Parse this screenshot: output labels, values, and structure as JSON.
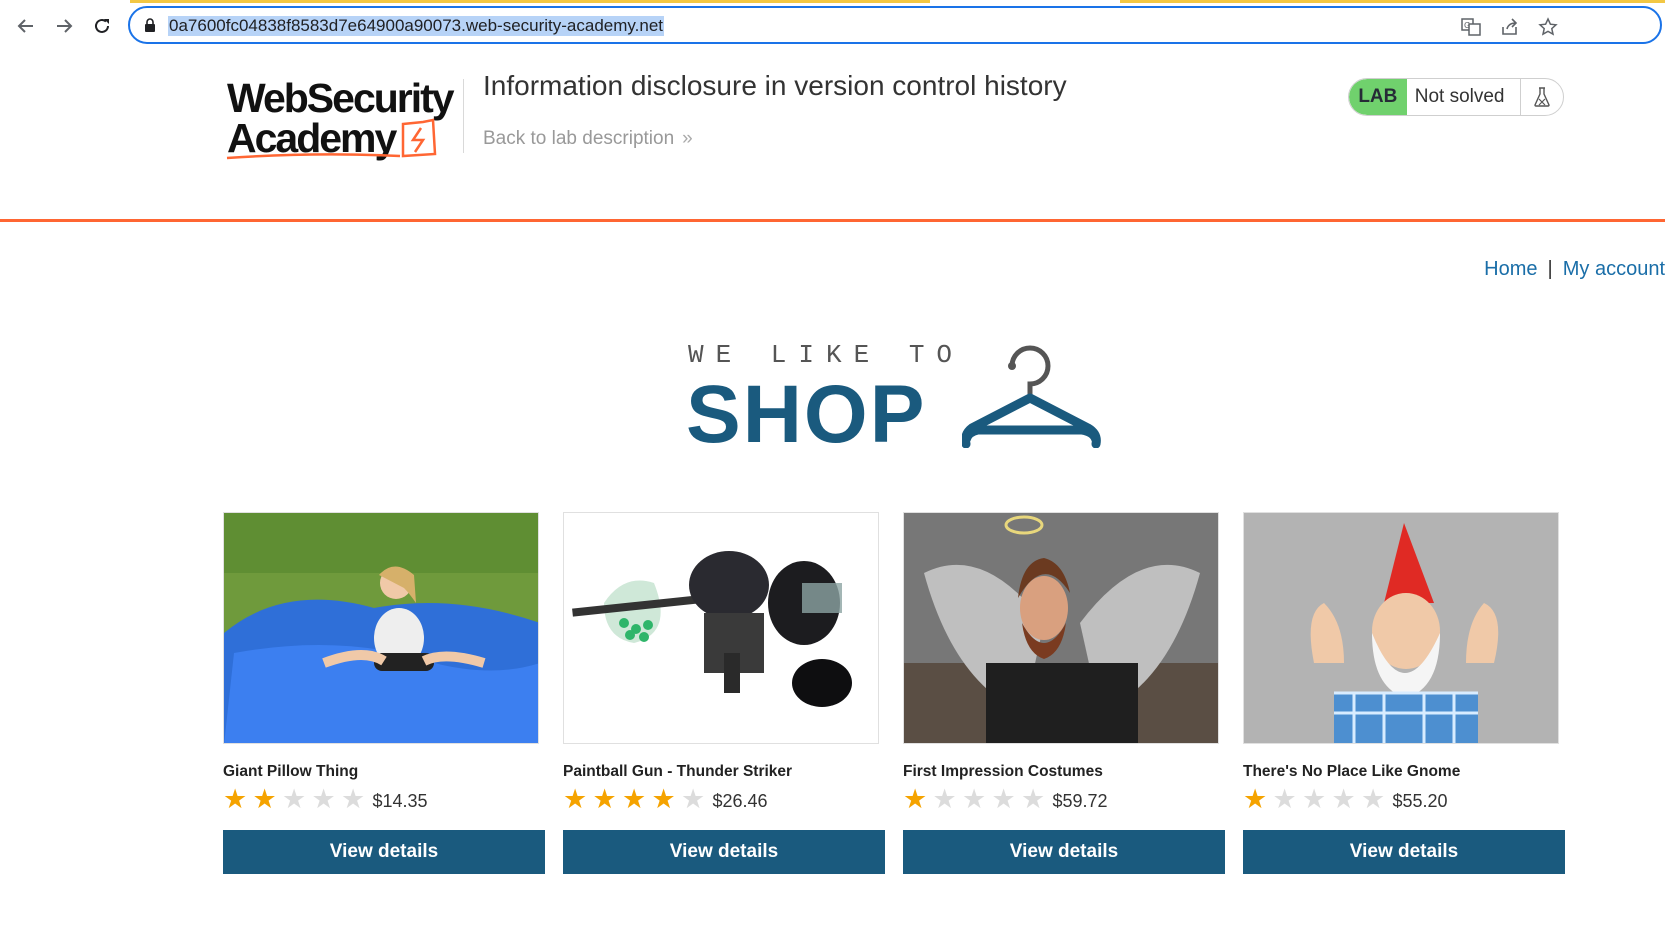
{
  "browser": {
    "url": "0a7600fc04838f8583d7e64900a90073.web-security-academy.net",
    "icons": [
      "back-icon",
      "forward-icon",
      "reload-icon",
      "lock-icon",
      "translate-icon",
      "share-icon",
      "bookmark-star-icon"
    ]
  },
  "lab": {
    "logo_line1": "WebSecurity",
    "logo_line2": "Academy",
    "title": "Information disclosure in version control history",
    "back_link": "Back to lab description",
    "badge": "LAB",
    "status": "Not solved",
    "accent_color": "#ff6633"
  },
  "nav": {
    "home": "Home",
    "separator": "|",
    "account": "My account"
  },
  "banner": {
    "tagline": "WE LIKE TO",
    "title": "SHOP"
  },
  "products": [
    {
      "name": "Giant Pillow Thing",
      "rating": 2,
      "price": "$14.35",
      "button": "View details"
    },
    {
      "name": "Paintball Gun - Thunder Striker",
      "rating": 4,
      "price": "$26.46",
      "button": "View details"
    },
    {
      "name": "First Impression Costumes",
      "rating": 1,
      "price": "$59.72",
      "button": "View details"
    },
    {
      "name": "There's No Place Like Gnome",
      "rating": 1,
      "price": "$55.20",
      "button": "View details"
    }
  ],
  "colors": {
    "primary": "#1a5a7e",
    "link": "#1a6ea8",
    "star": "#f5a300",
    "lab_badge": "#70d16d"
  }
}
